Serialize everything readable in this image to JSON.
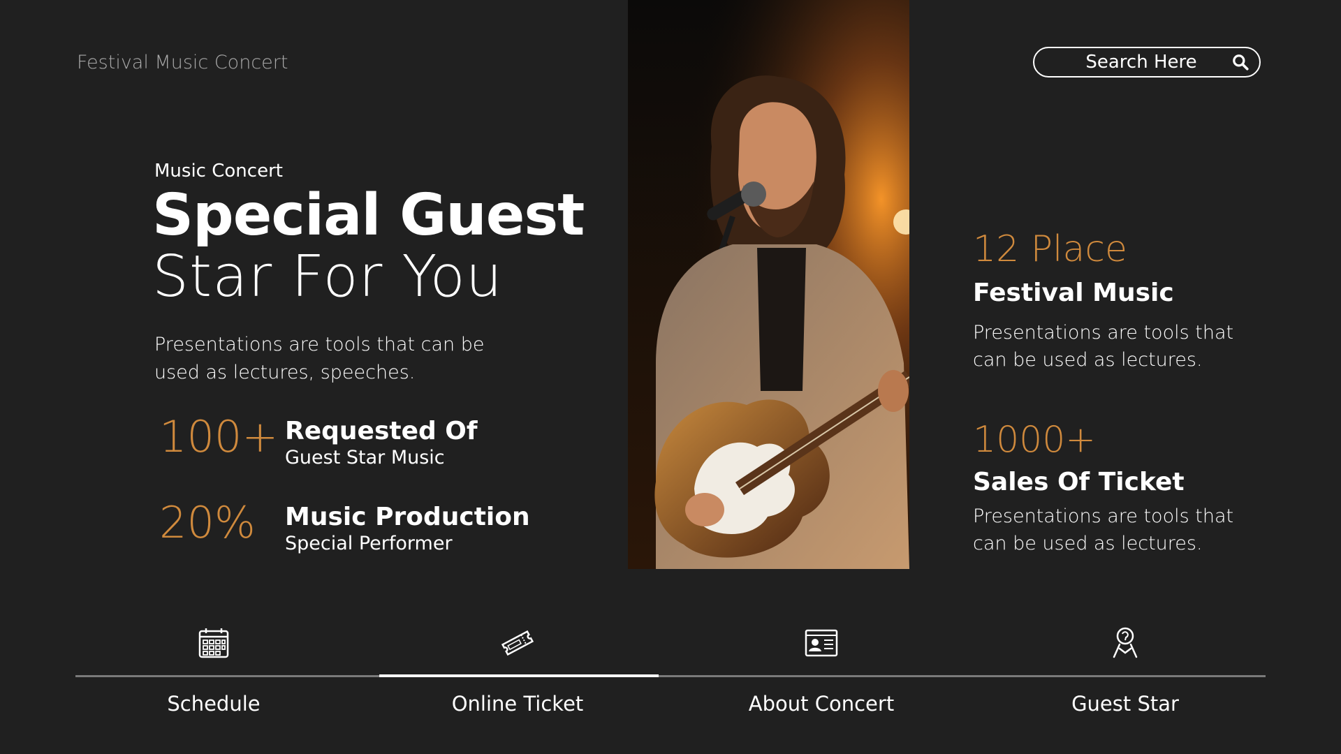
{
  "header": {
    "brand": "Festival Music Concert",
    "search_placeholder": "Search Here"
  },
  "hero": {
    "eyebrow": "Music Concert",
    "headline": "Special Guest",
    "subheadline": "Star For You",
    "intro": "Presentations are tools that can be used as lectures, speeches."
  },
  "stats": [
    {
      "value": "100+",
      "title": "Requested Of",
      "subtitle": "Guest Star Music"
    },
    {
      "value": "20%",
      "title": "Music Production",
      "subtitle": "Special Performer"
    }
  ],
  "right": [
    {
      "value": "12 Place",
      "title": "Festival Music",
      "desc": "Presentations are tools that can be used as lectures."
    },
    {
      "value": "1000+",
      "title": "Sales Of Ticket",
      "desc": "Presentations are tools that can be used as lectures."
    }
  ],
  "nav": {
    "items": [
      {
        "label": "Schedule",
        "icon": "calendar-icon"
      },
      {
        "label": "Online Ticket",
        "icon": "ticket-icon"
      },
      {
        "label": "About Concert",
        "icon": "id-card-icon"
      },
      {
        "label": "Guest Star",
        "icon": "guest-star-icon"
      }
    ],
    "active_index": 1
  },
  "colors": {
    "background": "#202020",
    "accent": "#d08a3d",
    "text": "#ffffff",
    "muted": "#a9a9a9"
  }
}
